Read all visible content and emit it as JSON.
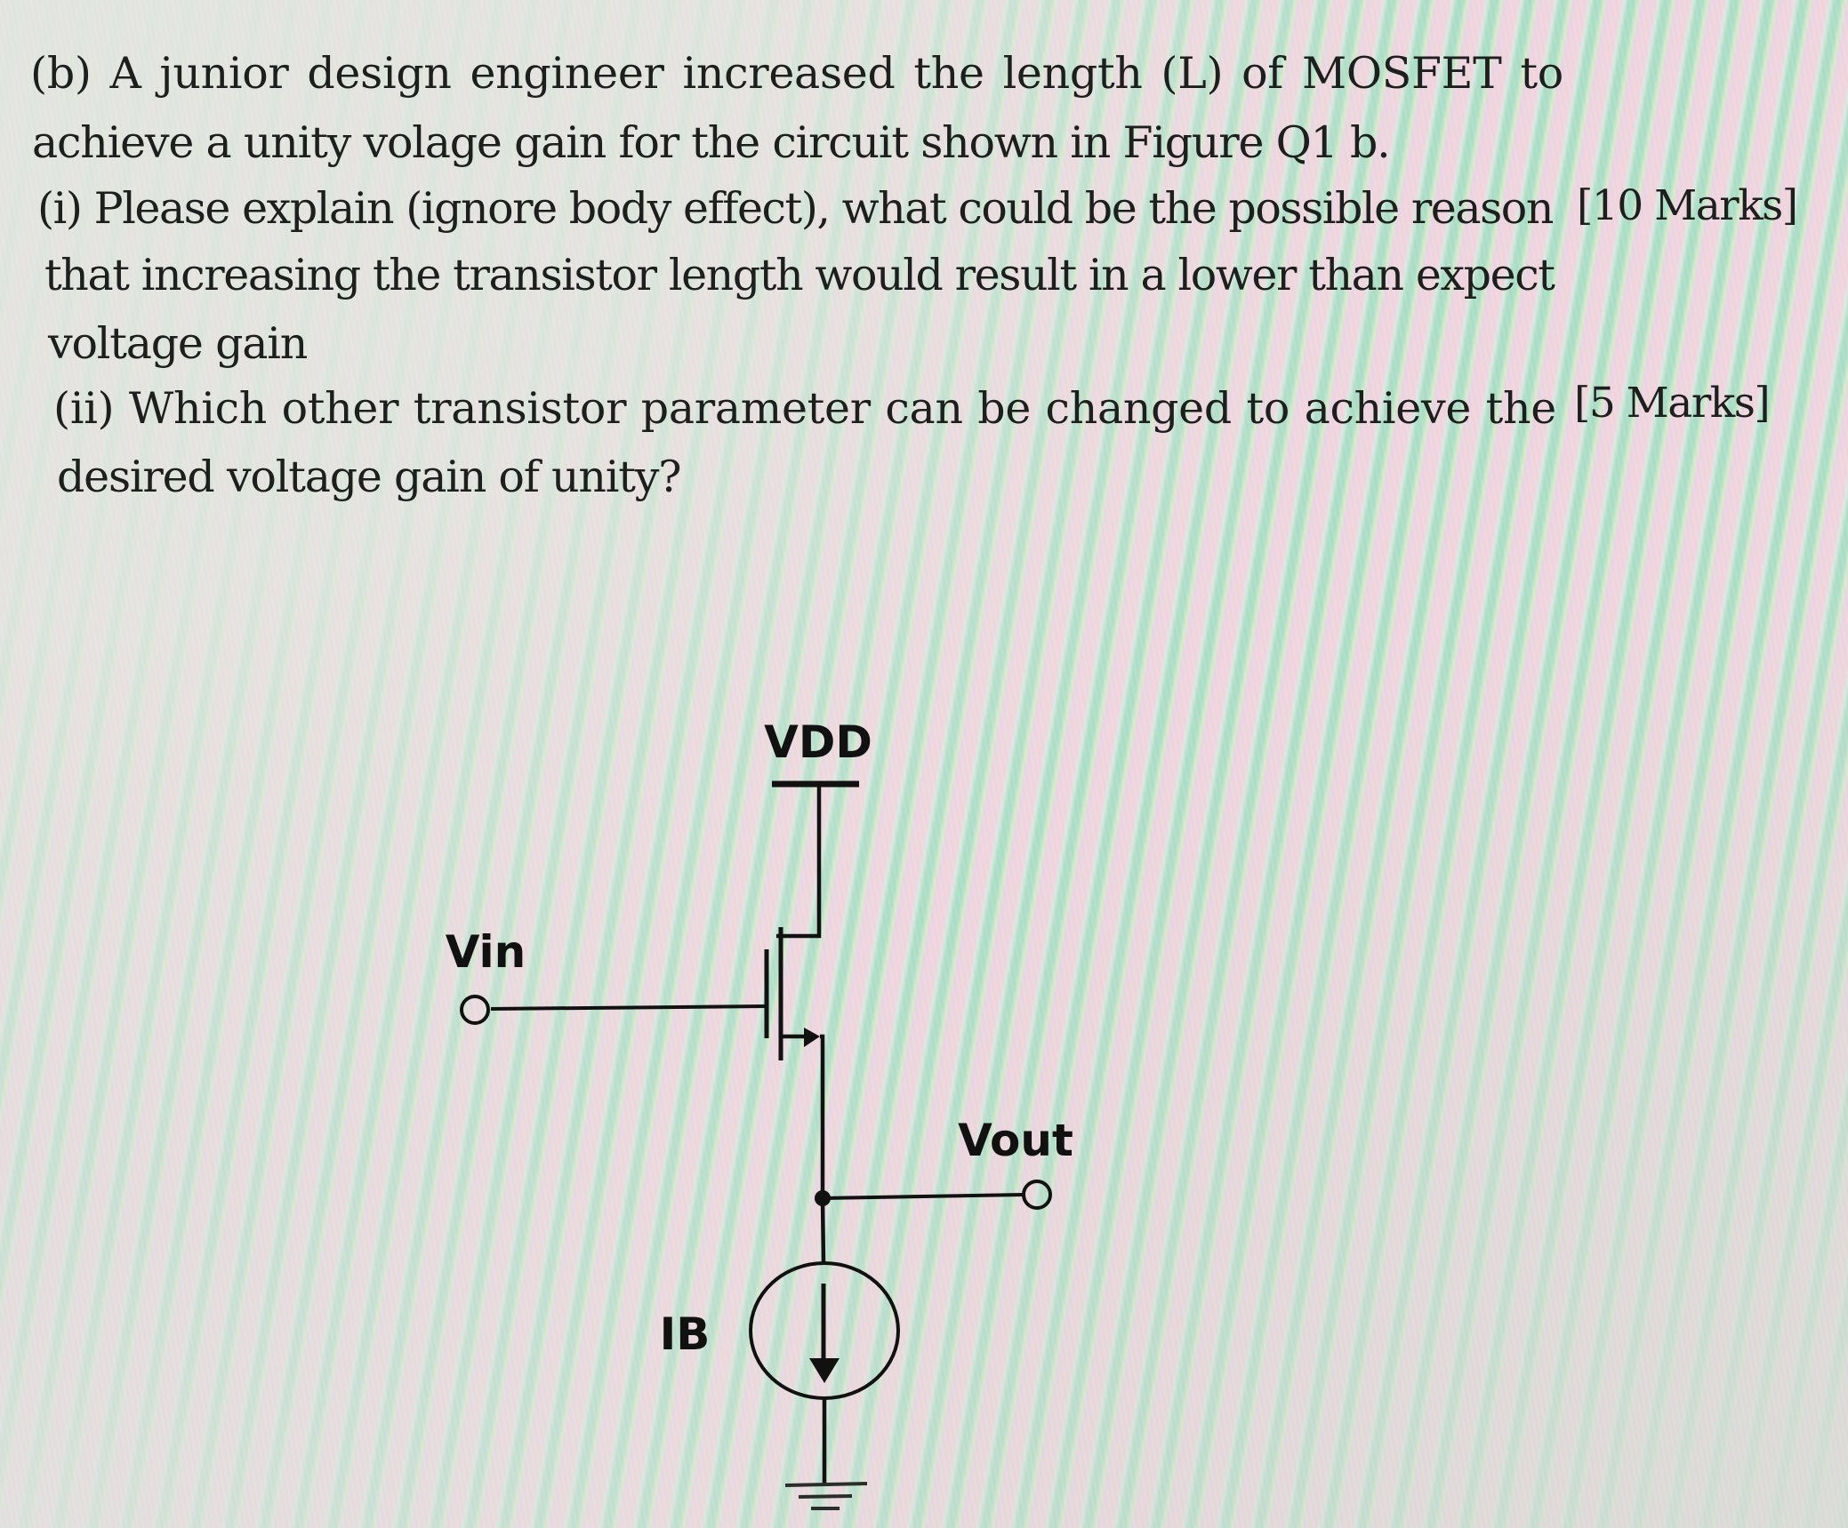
{
  "question": {
    "part_label": "(b)",
    "intro_line1_words": [
      "(b)",
      "A",
      "junior",
      "design",
      "engineer",
      "increased",
      "the",
      "length",
      "(L)",
      "of",
      "MOSFET",
      "to"
    ],
    "intro_line2": "achieve a unity volage gain for the circuit shown in Figure Q1 b.",
    "sub_i": {
      "line1": "(i) Please explain (ignore body effect), what could be the possible reason",
      "marks": "[10 Marks]",
      "line2": "that increasing the transistor length would result in a lower than expect",
      "line3": "voltage gain"
    },
    "sub_ii": {
      "line1_words": [
        "(ii)",
        "Which",
        "other",
        "transistor",
        "parameter",
        "can",
        "be",
        "changed",
        "to",
        "achieve",
        "the"
      ],
      "marks": "[5 Marks]",
      "line2": "desired voltage gain of unity?"
    }
  },
  "figure": {
    "caption_ref": "Figure Q1 b",
    "labels": {
      "supply": "VDD",
      "input": "Vin",
      "output": "Vout",
      "current_source": "IB"
    },
    "components": [
      "nmos-transistor",
      "current-source",
      "ground",
      "input-terminal",
      "output-terminal",
      "supply-rail"
    ]
  }
}
